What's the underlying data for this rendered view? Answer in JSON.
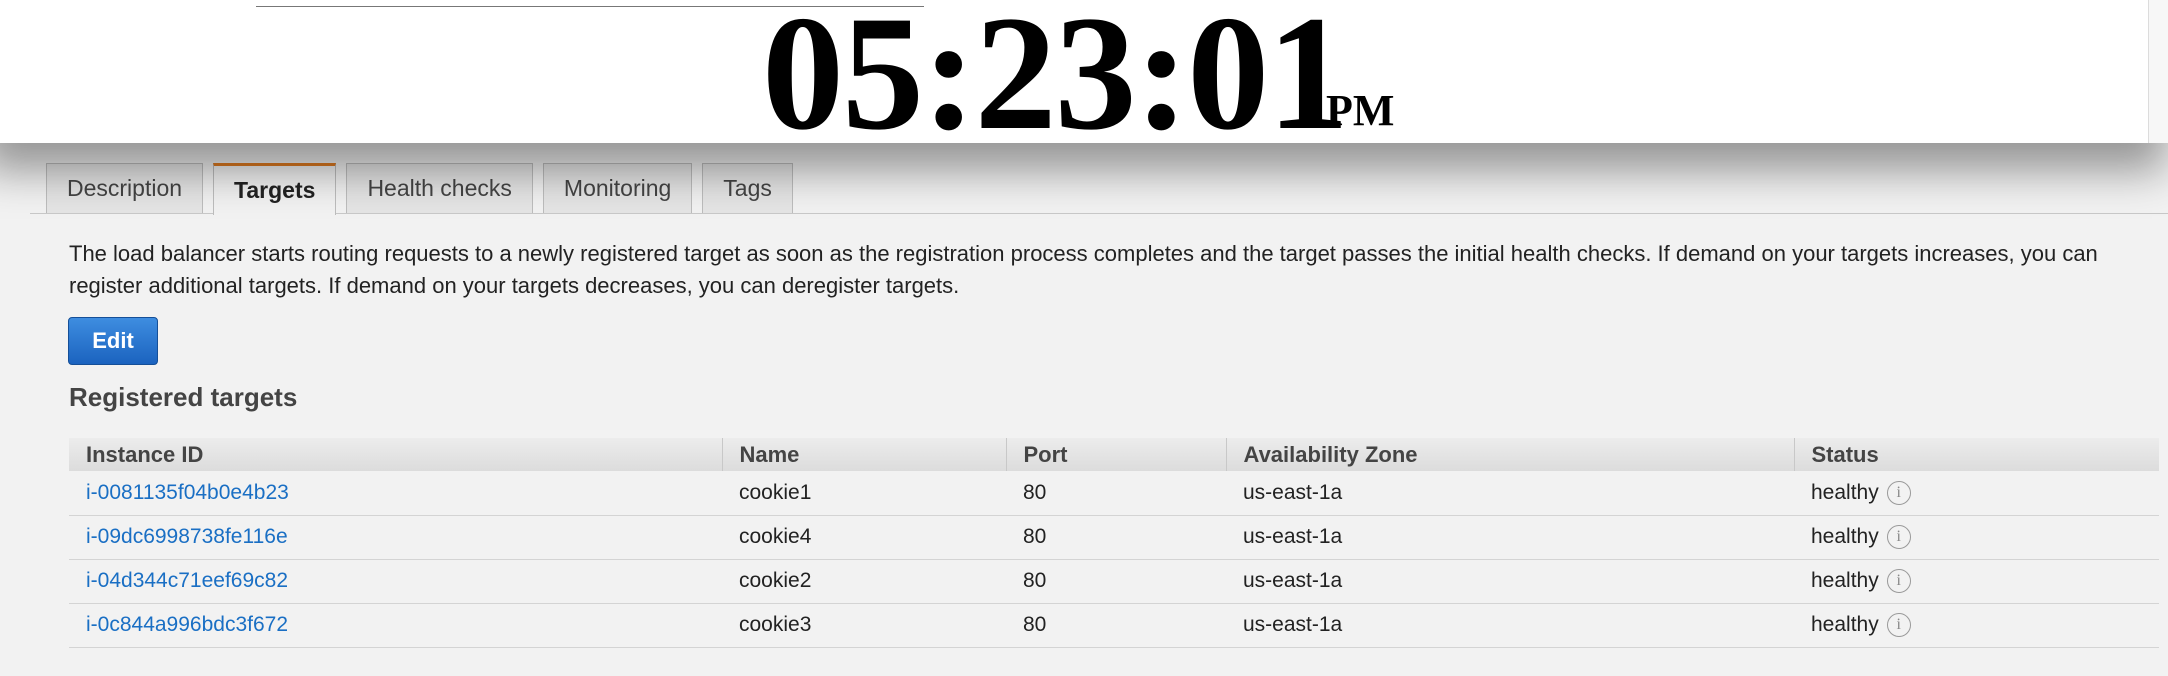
{
  "clock": {
    "time": "05:23:01",
    "ampm": "PM"
  },
  "tabs": [
    {
      "label": "Description",
      "active": false
    },
    {
      "label": "Targets",
      "active": true
    },
    {
      "label": "Health checks",
      "active": false
    },
    {
      "label": "Monitoring",
      "active": false
    },
    {
      "label": "Tags",
      "active": false
    }
  ],
  "targets_panel": {
    "description": "The load balancer starts routing requests to a newly registered target as soon as the registration process completes and the target passes the initial health checks. If demand on your targets increases, you can register additional targets. If demand on your targets decreases, you can deregister targets.",
    "edit_label": "Edit",
    "section_title": "Registered targets"
  },
  "table": {
    "headers": [
      "Instance ID",
      "Name",
      "Port",
      "Availability Zone",
      "Status"
    ],
    "rows": [
      {
        "instance_id": "i-0081135f04b0e4b23",
        "name": "cookie1",
        "port": "80",
        "zone": "us-east-1a",
        "status": "healthy"
      },
      {
        "instance_id": "i-09dc6998738fe116e",
        "name": "cookie4",
        "port": "80",
        "zone": "us-east-1a",
        "status": "healthy"
      },
      {
        "instance_id": "i-04d344c71eef69c82",
        "name": "cookie2",
        "port": "80",
        "zone": "us-east-1a",
        "status": "healthy"
      },
      {
        "instance_id": "i-0c844a996bdc3f672",
        "name": "cookie3",
        "port": "80",
        "zone": "us-east-1a",
        "status": "healthy"
      }
    ]
  },
  "icons": {
    "status_info": "info-icon"
  },
  "colors": {
    "active_tab_accent": "#e07b21",
    "link": "#1a6fc4",
    "button": "#1b63bf"
  }
}
